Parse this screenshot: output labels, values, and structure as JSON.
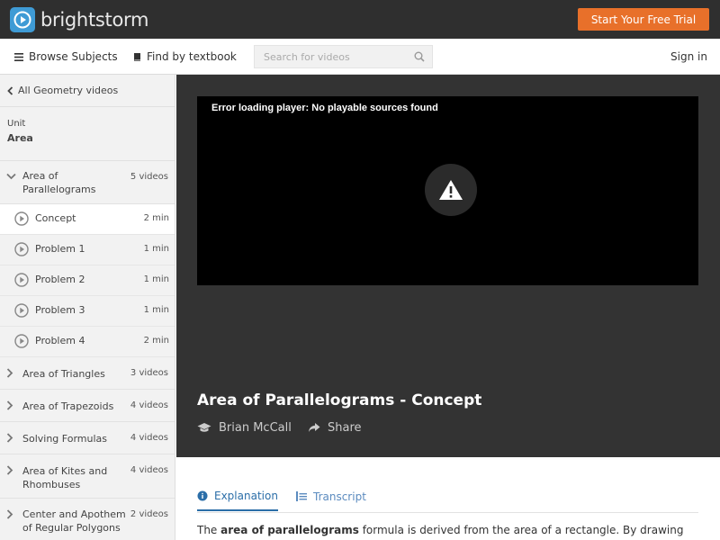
{
  "header": {
    "logo_text": "brightstorm",
    "cta_label": "Start Your Free Trial",
    "colors": {
      "bar": "#2f2f2f",
      "cta": "#e8702a",
      "logo_mark": "#3f9bd5"
    }
  },
  "nav": {
    "browse_label": "Browse Subjects",
    "textbook_label": "Find by textbook",
    "search_placeholder": "Search for videos",
    "signin_label": "Sign in"
  },
  "sidebar": {
    "back_label": "All Geometry videos",
    "unit_label": "Unit",
    "unit_name": "Area",
    "open_section": {
      "title_line1": "Area of",
      "title_line2": "Parallelograms",
      "count": "5 videos"
    },
    "lessons": [
      {
        "title": "Concept",
        "duration": "2 min"
      },
      {
        "title": "Problem 1",
        "duration": "1 min"
      },
      {
        "title": "Problem 2",
        "duration": "1 min"
      },
      {
        "title": "Problem 3",
        "duration": "1 min"
      },
      {
        "title": "Problem 4",
        "duration": "2 min"
      }
    ],
    "sections": [
      {
        "title_line1": "Area of Triangles",
        "title_line2": "",
        "count": "3 videos"
      },
      {
        "title_line1": "Area of Trapezoids",
        "title_line2": "",
        "count": "4 videos"
      },
      {
        "title_line1": "Solving Formulas",
        "title_line2": "",
        "count": "4 videos"
      },
      {
        "title_line1": "Area of Kites and",
        "title_line2": "Rhombuses",
        "count": "4 videos"
      },
      {
        "title_line1": "Center and Apothem",
        "title_line2": "of Regular Polygons",
        "count": "2 videos"
      }
    ]
  },
  "player": {
    "error_text": "Error loading player: No playable sources found",
    "video_title": "Area of Parallelograms - Concept",
    "author": "Brian McCall",
    "share_label": "Share"
  },
  "tabs": {
    "explanation": "Explanation",
    "transcript": "Transcript"
  },
  "explanation": {
    "prefix": "The ",
    "bold": "area of parallelograms",
    "suffix": " formula is derived from the area of a rectangle. By drawing"
  }
}
